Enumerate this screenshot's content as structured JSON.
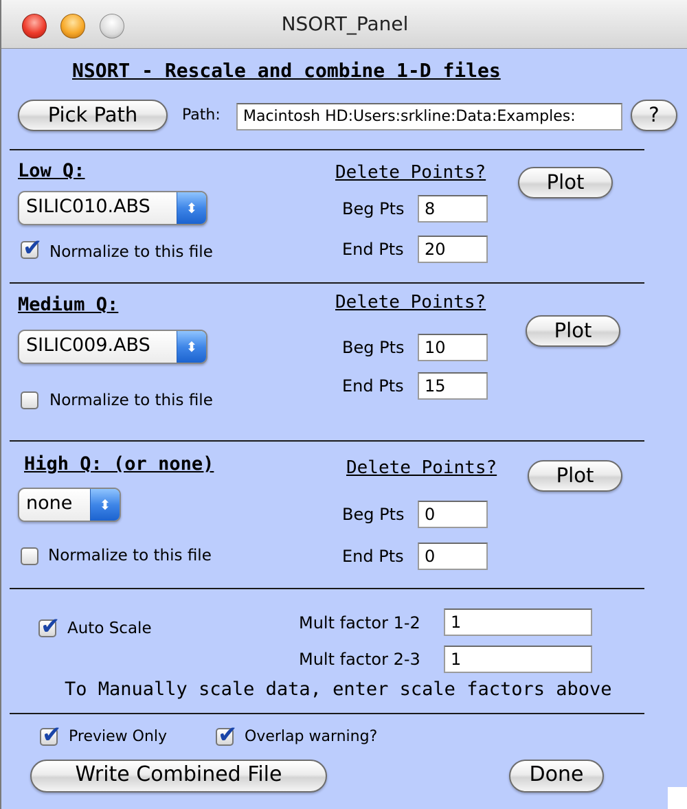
{
  "window": {
    "title": "NSORT_Panel"
  },
  "header": {
    "title": "NSORT - Rescale and combine 1-D files",
    "pick_path_label": "Pick Path",
    "path_label": "Path:",
    "path_value": "Macintosh HD:Users:srkline:Data:Examples:",
    "help_label": "?"
  },
  "low_q": {
    "heading": "Low Q:",
    "file": "SILIC010.ABS",
    "normalize_label": "Normalize to this file",
    "normalize_checked": true,
    "delete_heading": "Delete Points?",
    "plot_label": "Plot",
    "beg_label": "Beg Pts",
    "beg_value": "8",
    "end_label": "End Pts",
    "end_value": "20"
  },
  "medium_q": {
    "heading": "Medium Q:",
    "file": "SILIC009.ABS",
    "normalize_label": "Normalize to this file",
    "normalize_checked": false,
    "delete_heading": "Delete Points?",
    "plot_label": "Plot",
    "beg_label": "Beg Pts",
    "beg_value": "10",
    "end_label": "End Pts",
    "end_value": "15"
  },
  "high_q": {
    "heading": "High Q: (or none)",
    "file": "none",
    "normalize_label": "Normalize to this file",
    "normalize_checked": false,
    "delete_heading": "Delete Points?",
    "plot_label": "Plot",
    "beg_label": "Beg Pts",
    "beg_value": "0",
    "end_label": "End Pts",
    "end_value": "0"
  },
  "scaling": {
    "auto_scale_label": "Auto Scale",
    "auto_scale_checked": true,
    "mult12_label": "Mult factor 1-2",
    "mult12_value": "1",
    "mult23_label": "Mult factor 2-3",
    "mult23_value": "1",
    "note": "To Manually scale data, enter scale factors above"
  },
  "footer": {
    "preview_label": "Preview Only",
    "preview_checked": true,
    "overlap_label": "Overlap warning?",
    "overlap_checked": true,
    "write_label": "Write Combined File",
    "done_label": "Done"
  },
  "icons": {
    "check": "checkmark-icon",
    "popup_arrows": "up-down-arrows-icon"
  },
  "colors": {
    "panel_background": "#bccdfd",
    "popup_arrow": "#3f86e8",
    "checkmark": "#1a45a8"
  }
}
